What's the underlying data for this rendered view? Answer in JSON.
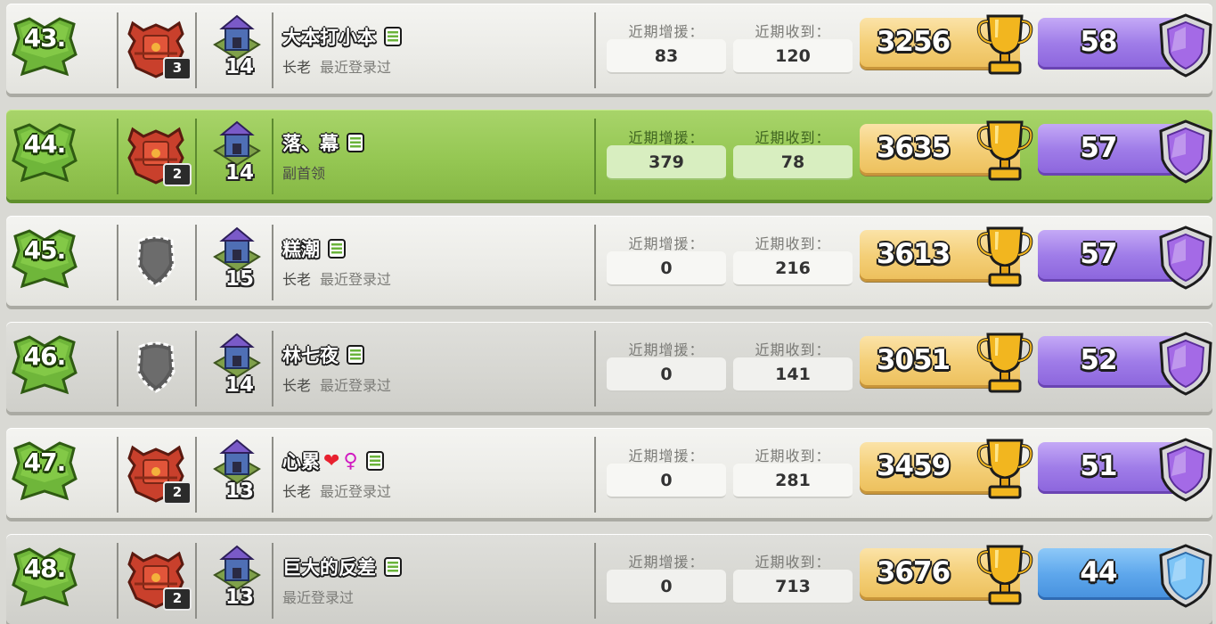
{
  "labels": {
    "donations": "近期增援：",
    "received": "近期收到："
  },
  "colors": {
    "highlight_row": "#95c753",
    "trophy_gold": "#f4cf78",
    "amethyst_league": "#9f7ce8",
    "crystal_league": "#5ea7ec"
  },
  "members": [
    {
      "rank": "43.",
      "name": "大本打小本",
      "name_extras": [],
      "role": "长老",
      "last_seen": "最近登录过",
      "clan_league_level": "3",
      "has_clan_league": true,
      "town_hall_level": "14",
      "donations": "83",
      "received": "120",
      "trophies": "3256",
      "league_level": "58",
      "league_type": "amethyst",
      "highlighted": false,
      "alt": false
    },
    {
      "rank": "44.",
      "name": "落、幕",
      "name_extras": [],
      "role": "副首领",
      "last_seen": "",
      "clan_league_level": "2",
      "has_clan_league": true,
      "town_hall_level": "14",
      "donations": "379",
      "received": "78",
      "trophies": "3635",
      "league_level": "57",
      "league_type": "amethyst",
      "highlighted": true,
      "alt": false
    },
    {
      "rank": "45.",
      "name": "糕潮",
      "name_extras": [],
      "role": "长老",
      "last_seen": "最近登录过",
      "clan_league_level": "",
      "has_clan_league": false,
      "town_hall_level": "15",
      "donations": "0",
      "received": "216",
      "trophies": "3613",
      "league_level": "57",
      "league_type": "amethyst",
      "highlighted": false,
      "alt": false
    },
    {
      "rank": "46.",
      "name": "林七夜",
      "name_extras": [],
      "role": "长老",
      "last_seen": "最近登录过",
      "clan_league_level": "",
      "has_clan_league": false,
      "town_hall_level": "14",
      "donations": "0",
      "received": "141",
      "trophies": "3051",
      "league_level": "52",
      "league_type": "amethyst",
      "highlighted": false,
      "alt": true
    },
    {
      "rank": "47.",
      "name": "心累",
      "name_extras": [
        "heart",
        "female"
      ],
      "role": "长老",
      "last_seen": "最近登录过",
      "clan_league_level": "2",
      "has_clan_league": true,
      "town_hall_level": "13",
      "donations": "0",
      "received": "281",
      "trophies": "3459",
      "league_level": "51",
      "league_type": "amethyst",
      "highlighted": false,
      "alt": false
    },
    {
      "rank": "48.",
      "name": "巨大的反差",
      "name_extras": [],
      "role": "",
      "last_seen": "最近登录过",
      "clan_league_level": "2",
      "has_clan_league": true,
      "town_hall_level": "13",
      "donations": "0",
      "received": "713",
      "trophies": "3676",
      "league_level": "44",
      "league_type": "crystal",
      "highlighted": false,
      "alt": true
    }
  ]
}
